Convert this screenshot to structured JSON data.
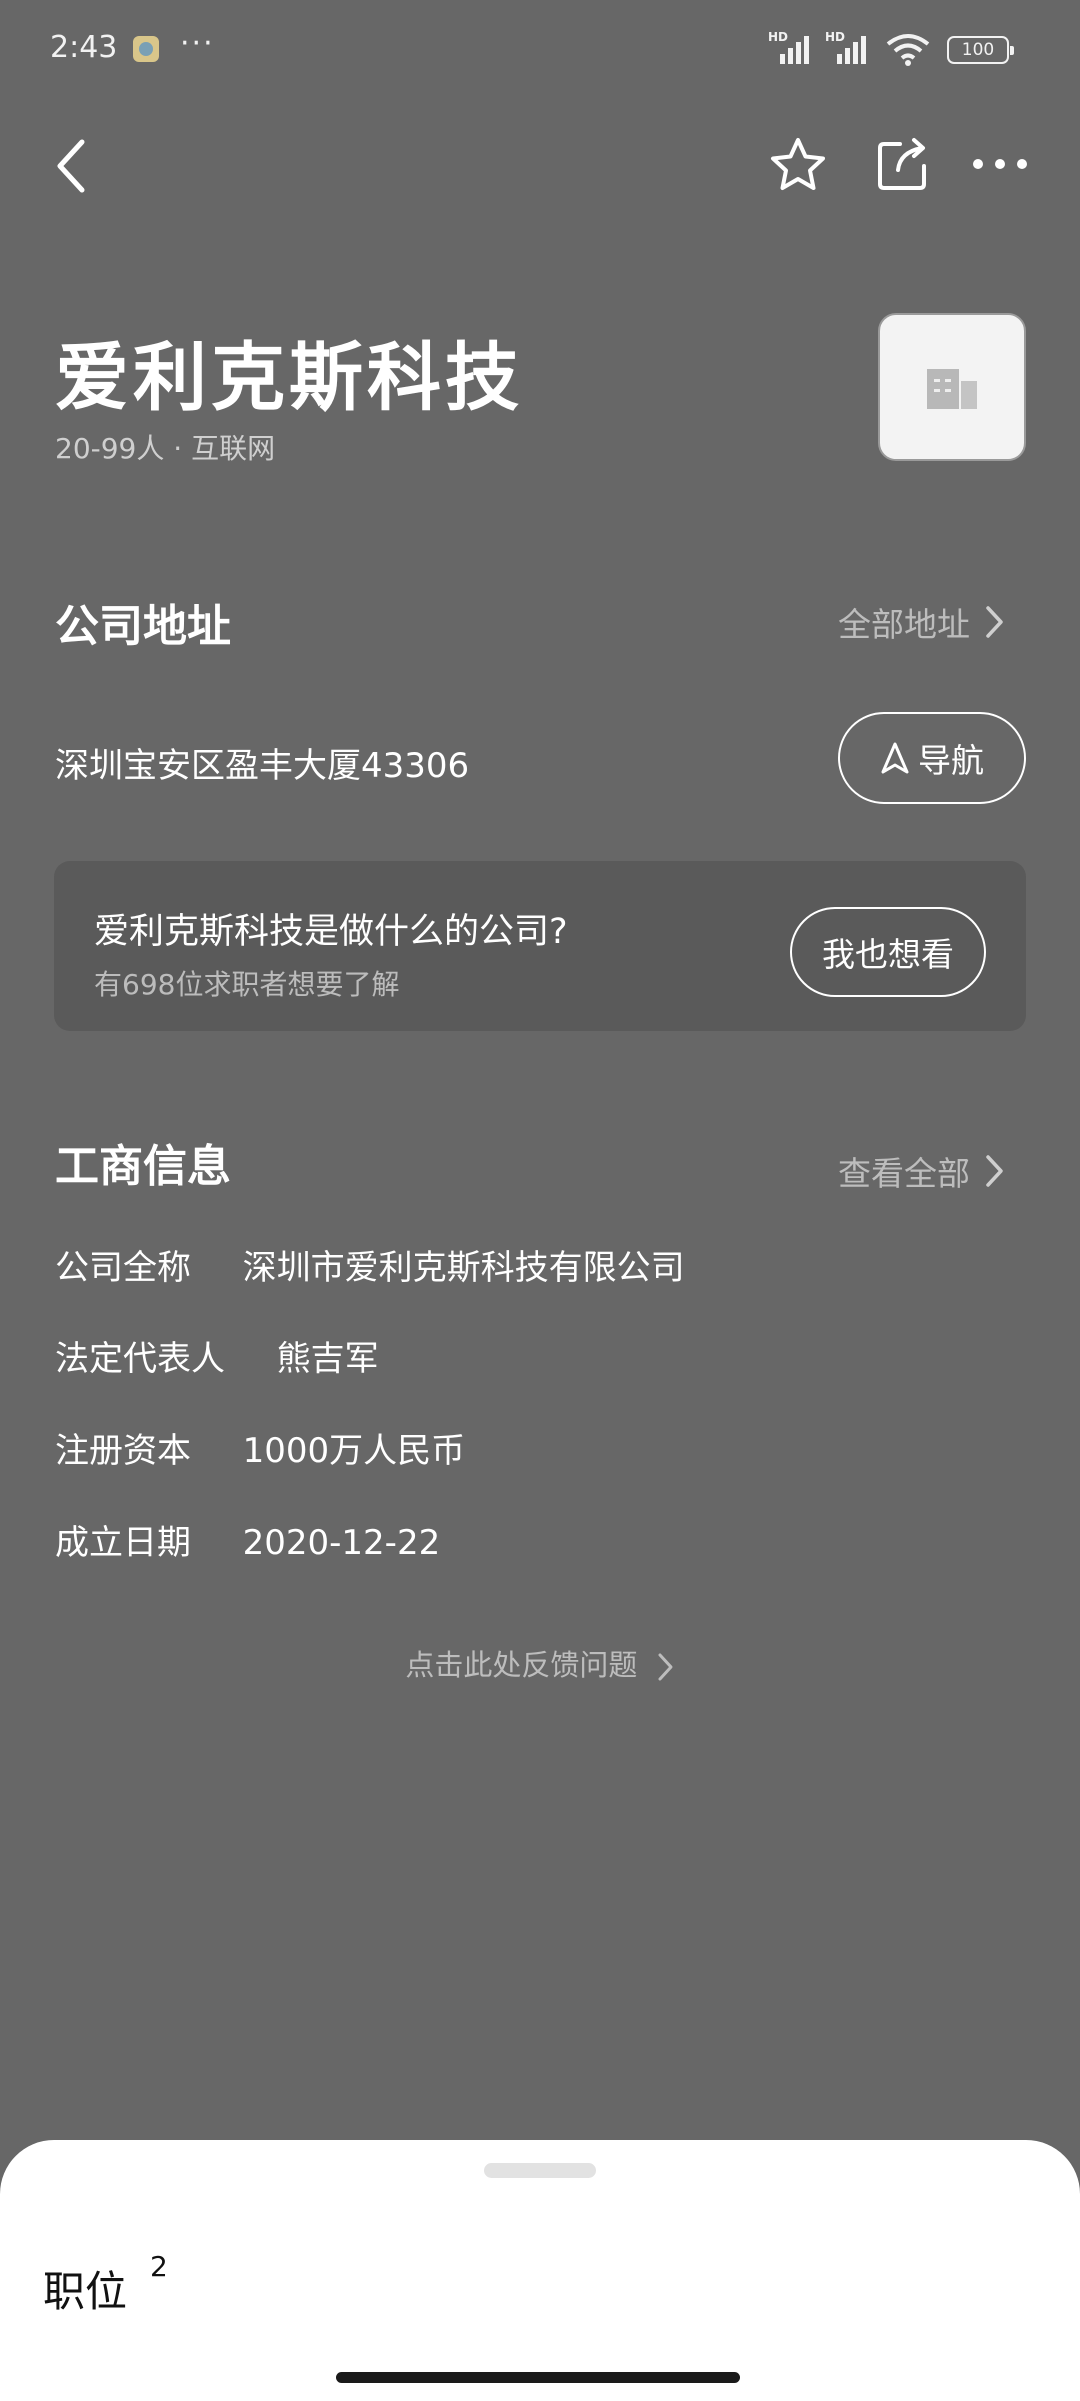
{
  "status_bar": {
    "time": "2:43",
    "dots": "···",
    "sim1": "HD",
    "sim2": "HD",
    "battery": "100"
  },
  "header": {
    "company_name": "爱利克斯科技",
    "meta": "20-99人 · 互联网"
  },
  "address_section": {
    "title": "公司地址",
    "more_label": "全部地址",
    "address": "深圳宝安区盈丰大厦43306",
    "nav_label": "导航"
  },
  "ask_card": {
    "question": "爱利克斯科技是做什么的公司?",
    "subtitle": "有698位求职者想要了解",
    "button": "我也想看"
  },
  "business_section": {
    "title": "工商信息",
    "more_label": "查看全部",
    "rows": [
      {
        "label": "公司全称",
        "value": "深圳市爱利克斯科技有限公司"
      },
      {
        "label": "法定代表人",
        "value": "熊吉军"
      },
      {
        "label": "注册资本",
        "value": "1000万人民币"
      },
      {
        "label": "成立日期",
        "value": "2020-12-22"
      }
    ]
  },
  "feedback": "点击此处反馈问题",
  "sheet": {
    "title": "职位",
    "count": "2"
  },
  "colors": {
    "background": "#676767",
    "card": "#5a5a5a",
    "sheet": "#ffffff"
  },
  "icons": [
    "back-arrow-icon",
    "star-icon",
    "share-icon",
    "more-icon",
    "building-icon",
    "navigation-arrow-icon",
    "chevron-right-icon"
  ]
}
